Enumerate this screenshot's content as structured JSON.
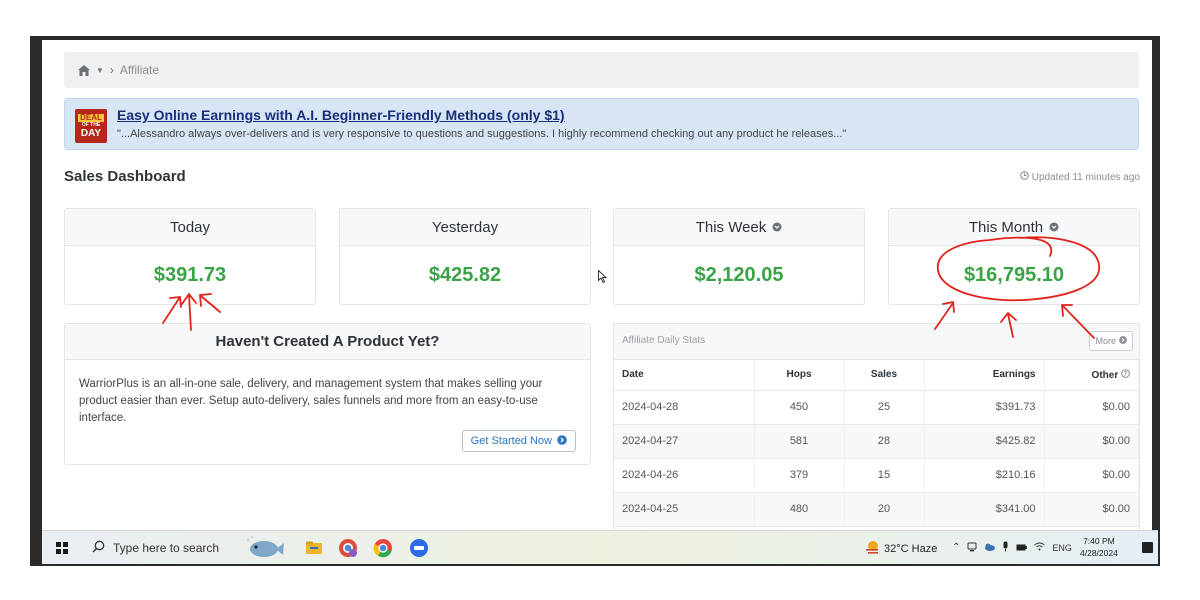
{
  "breadcrumb": {
    "current": "Affiliate"
  },
  "deal": {
    "badge_line1": "DEAL",
    "badge_line2": "OF THE",
    "badge_line3": "DAY",
    "title": "Easy Online Earnings with A.I. Beginner-Friendly Methods (only $1)",
    "quote": "\"...Alessandro always over-delivers and is very responsive to questions and suggestions. I highly recommend checking out any product he releases...\""
  },
  "dashboard": {
    "title": "Sales Dashboard",
    "updated": "Updated 11 minutes ago",
    "cards": [
      {
        "label": "Today",
        "value": "$391.73"
      },
      {
        "label": "Yesterday",
        "value": "$425.82"
      },
      {
        "label": "This Week",
        "value": "$2,120.05"
      },
      {
        "label": "This Month",
        "value": "$16,795.10"
      }
    ]
  },
  "cta": {
    "title": "Haven't Created A Product Yet?",
    "body": "WarriorPlus is an all-in-one sale, delivery, and management system that makes selling your product easier than ever. Setup auto-delivery, sales funnels and more from an easy-to-use interface.",
    "button": "Get Started Now"
  },
  "stats": {
    "title": "Affiliate Daily Stats",
    "more": "More",
    "columns": [
      "Date",
      "Hops",
      "Sales",
      "Earnings",
      "Other"
    ],
    "rows": [
      [
        "2024-04-28",
        "450",
        "25",
        "$391.73",
        "$0.00"
      ],
      [
        "2024-04-27",
        "581",
        "28",
        "$425.82",
        "$0.00"
      ],
      [
        "2024-04-26",
        "379",
        "15",
        "$210.16",
        "$0.00"
      ],
      [
        "2024-04-25",
        "480",
        "20",
        "$341.00",
        "$0.00"
      ]
    ]
  },
  "taskbar": {
    "search_placeholder": "Type here to search",
    "weather": "32°C  Haze",
    "lang": "ENG",
    "time": "7:40 PM",
    "date": "4/28/2024"
  },
  "colors": {
    "accent_green": "#3aa346",
    "annotation_red": "#e0231b",
    "deal_bg": "#d7e5f5"
  }
}
